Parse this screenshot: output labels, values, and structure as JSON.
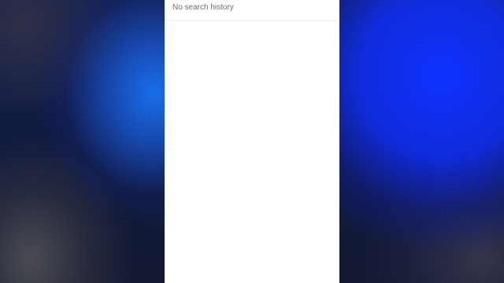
{
  "search_history": {
    "empty_message": "No search history"
  }
}
